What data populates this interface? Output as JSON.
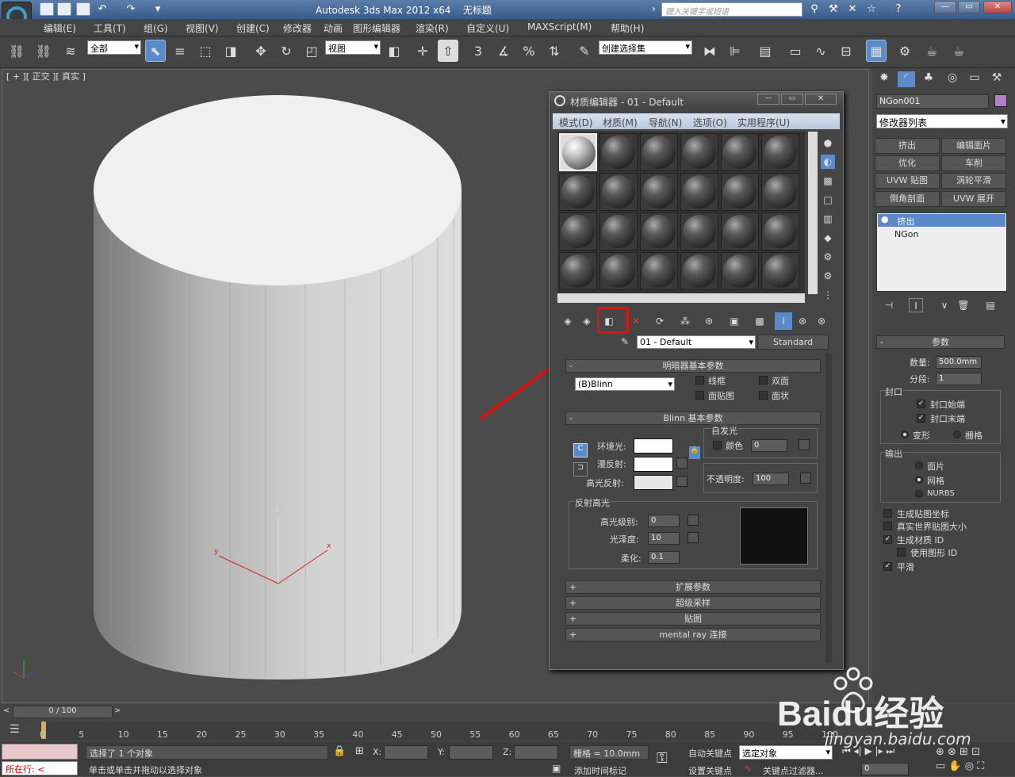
{
  "title": {
    "app": "Autodesk 3ds Max  2012 x64",
    "doc": "无标题",
    "search_placeholder": "键入关键字或短语"
  },
  "menu": [
    "编辑(E)",
    "工具(T)",
    "组(G)",
    "视图(V)",
    "创建(C)",
    "修改器",
    "动画",
    "图形编辑器",
    "渲染(R)",
    "自定义(U)",
    "MAXScript(M)",
    "帮助(H)"
  ],
  "toolbar": {
    "filter": "全部",
    "coord": "视图",
    "angle_snap": "3",
    "percent_snap": "%",
    "selection_set": "创建选择集"
  },
  "viewport": {
    "label": "[ + ][ 正交 ][ 真实 ]"
  },
  "cmd": {
    "object_name": "NGon001",
    "modifier_list": "修改器列表",
    "buttons": [
      "挤出",
      "编辑面片",
      "优化",
      "车削",
      "UVW 贴图",
      "涡轮平滑",
      "倒角剖面",
      "UVW 展开"
    ],
    "stack": [
      "挤出",
      "NGon"
    ],
    "params_title": "参数",
    "amount_label": "数量:",
    "amount": "500.0mm",
    "segments_label": "分段:",
    "segments": "1",
    "cap_title": "封口",
    "cap_start": "封口始端",
    "cap_end": "封口末端",
    "morph": "变形",
    "grid": "栅格",
    "output_title": "输出",
    "patch": "面片",
    "mesh": "网格",
    "nurbs": "NURBS",
    "gen_map": "生成贴图坐标",
    "real_world": "真实世界贴图大小",
    "gen_matid": "生成材质 ID",
    "use_shape_id": "使用图形 ID",
    "smooth": "平滑"
  },
  "mat": {
    "title": "材质编辑器 - 01 - Default",
    "menu": [
      "模式(D)",
      "材质(M)",
      "导航(N)",
      "选项(O)",
      "实用程序(U)"
    ],
    "material_name": "01 - Default",
    "material_type": "Standard",
    "shader_rollout": "明暗器基本参数",
    "shader": "(B)Blinn",
    "wire": "线框",
    "two_sided": "双面",
    "face_map": "面贴图",
    "faceted": "面状",
    "blinn_rollout": "Blinn 基本参数",
    "self_illum": "自发光",
    "color": "颜色",
    "self_illum_value": "0",
    "ambient": "环境光:",
    "diffuse": "漫反射:",
    "specular": "高光反射:",
    "opacity_label": "不透明度:",
    "opacity": "100",
    "spec_title": "反射高光",
    "spec_level_label": "高光级别:",
    "spec_level": "0",
    "gloss_label": "光泽度:",
    "gloss": "10",
    "soften_label": "柔化:",
    "soften": "0.1",
    "rollouts": [
      "扩展参数",
      "超级采样",
      "贴图",
      "mental ray 连接"
    ]
  },
  "timeline": {
    "frame": "0 / 100",
    "ticks": [
      "0",
      "5",
      "10",
      "15",
      "20",
      "25",
      "30",
      "35",
      "40",
      "45",
      "50",
      "55",
      "60",
      "65",
      "70",
      "75",
      "80",
      "85",
      "90",
      "95",
      "100"
    ]
  },
  "status": {
    "selected": "选择了 1 个对象",
    "hint": "单击或单击并拖动以选择对象",
    "mode": "所在行:",
    "x_label": "X:",
    "y_label": "Y:",
    "z_label": "Z:",
    "grid": "栅格 = 10.0mm",
    "auto_key": "自动关键点",
    "set_key": "设置关键点",
    "sel_obj": "选定对象",
    "key_filter": "关键点过滤器...",
    "add_time_tag": "添加时间标记",
    "frame": "0"
  },
  "watermark": {
    "brand": "Baidu经验",
    "url": "jingyan.baidu.com"
  },
  "colors": {
    "highlight_box": "#e01010",
    "arrow": "#e01010"
  }
}
